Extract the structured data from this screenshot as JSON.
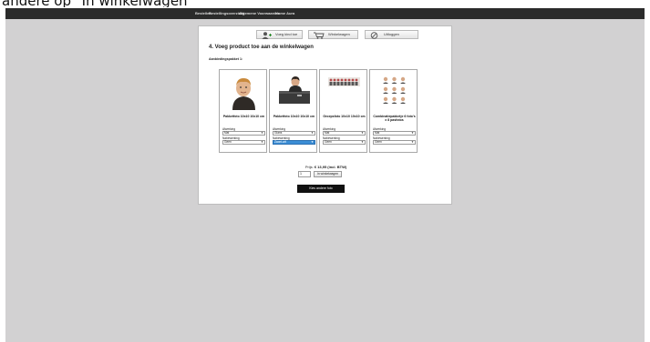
{
  "caption": "andere op \"In winkelwagen\"",
  "topnav": {
    "items": [
      "Bestellen",
      "Bestellingsoverzicht",
      "Algemene Voorwaarden",
      "Home Aura"
    ]
  },
  "steps": [
    {
      "label": "Voeg kind toe",
      "icon": "add-user-icon"
    },
    {
      "label": "Winkelwagen",
      "icon": "cart-icon"
    },
    {
      "label": "Uitloggen",
      "icon": "logout-icon"
    }
  ],
  "heading": "4. Voeg product toe aan de winkelwagen",
  "sublabel": "Aanbiedingspakket 1:",
  "labels": {
    "afwerking": "Afwerking",
    "nabewerking": "Nabewerking"
  },
  "products": [
    {
      "title": "Pakketfoto 10x10 10x10 cm",
      "afwerking": "Mat",
      "nabewerking": "Geen",
      "thumb": "child-portrait"
    },
    {
      "title": "Pakketfoto 10x10 10x10 cm",
      "afwerking": "Glans",
      "nabewerking": "Zwart-wit",
      "thumb": "child-at-desk"
    },
    {
      "title": "Groepsfoto 10x10 10x10 cm",
      "afwerking": "Mat",
      "nabewerking": "Geen",
      "thumb": "group-photo"
    },
    {
      "title": "Combinatiepakketje 6 foto's x 8 pasfotos",
      "afwerking": "Mat",
      "nabewerking": "Geen",
      "thumb": "passport-sheet"
    }
  ],
  "price": {
    "label": "Prijs:",
    "value": "€ 13,95 (incl. BTW)"
  },
  "cart": {
    "quantity": "1",
    "add_label": "In winkelwagen"
  },
  "next_label": "Kies andere foto",
  "colors": {
    "nav": "#2b2b2b",
    "background": "#d2d1d2",
    "selected": "#3b8ed6"
  }
}
